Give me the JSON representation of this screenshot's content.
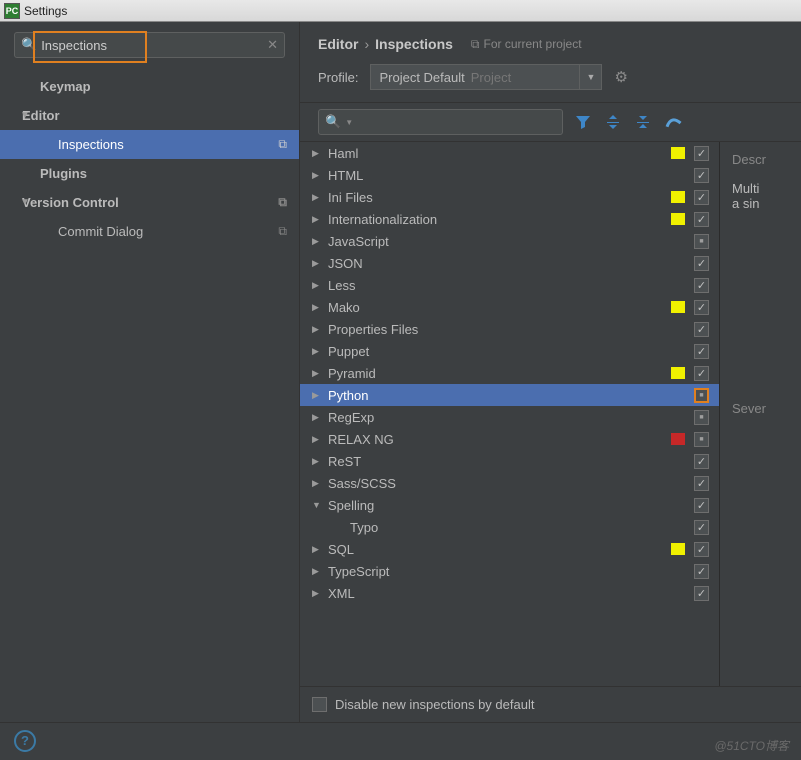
{
  "window": {
    "title": "Settings",
    "app_icon": "PC"
  },
  "sidebar": {
    "search": {
      "value": "Inspections",
      "clear_glyph": "✕"
    },
    "items": [
      {
        "label": "Keymap",
        "level": 1,
        "bold": true
      },
      {
        "label": "Editor",
        "level": 0,
        "bold": true,
        "expanded": true
      },
      {
        "label": "Inspections",
        "level": 2,
        "selected": true,
        "copy": true
      },
      {
        "label": "Plugins",
        "level": 1,
        "bold": true
      },
      {
        "label": "Version Control",
        "level": 0,
        "bold": true,
        "expanded": true,
        "copy": true
      },
      {
        "label": "Commit Dialog",
        "level": 2,
        "copy": true
      }
    ]
  },
  "breadcrumb": {
    "a": "Editor",
    "b": "Inspections",
    "proj": "For current project"
  },
  "profile": {
    "label": "Profile:",
    "value": "Project Default",
    "suffix": "Project"
  },
  "categories": [
    {
      "name": "Haml",
      "sev": "yellow",
      "state": "checked"
    },
    {
      "name": "HTML",
      "sev": "",
      "state": "checked"
    },
    {
      "name": "Ini Files",
      "sev": "yellow",
      "state": "checked"
    },
    {
      "name": "Internationalization",
      "sev": "yellow",
      "state": "checked"
    },
    {
      "name": "JavaScript",
      "sev": "",
      "state": "mixed"
    },
    {
      "name": "JSON",
      "sev": "",
      "state": "checked"
    },
    {
      "name": "Less",
      "sev": "",
      "state": "checked"
    },
    {
      "name": "Mako",
      "sev": "yellow",
      "state": "checked"
    },
    {
      "name": "Properties Files",
      "sev": "",
      "state": "checked"
    },
    {
      "name": "Puppet",
      "sev": "",
      "state": "checked"
    },
    {
      "name": "Pyramid",
      "sev": "yellow",
      "state": "checked"
    },
    {
      "name": "Python",
      "sev": "",
      "state": "mixed",
      "selected": true
    },
    {
      "name": "RegExp",
      "sev": "",
      "state": "mixed"
    },
    {
      "name": "RELAX NG",
      "sev": "red",
      "state": "mixed"
    },
    {
      "name": "ReST",
      "sev": "",
      "state": "checked"
    },
    {
      "name": "Sass/SCSS",
      "sev": "",
      "state": "checked"
    },
    {
      "name": "Spelling",
      "sev": "",
      "state": "checked",
      "expanded": true
    },
    {
      "name": "Typo",
      "sev": "",
      "state": "checked",
      "child": true
    },
    {
      "name": "SQL",
      "sev": "yellow",
      "state": "checked"
    },
    {
      "name": "TypeScript",
      "sev": "",
      "state": "checked"
    },
    {
      "name": "XML",
      "sev": "",
      "state": "checked"
    }
  ],
  "disable_label": "Disable new inspections by default",
  "description": {
    "header": "Descr",
    "body1": "Multi",
    "body2": "a sin",
    "severity": "Sever"
  },
  "watermark": "@51CTO博客"
}
